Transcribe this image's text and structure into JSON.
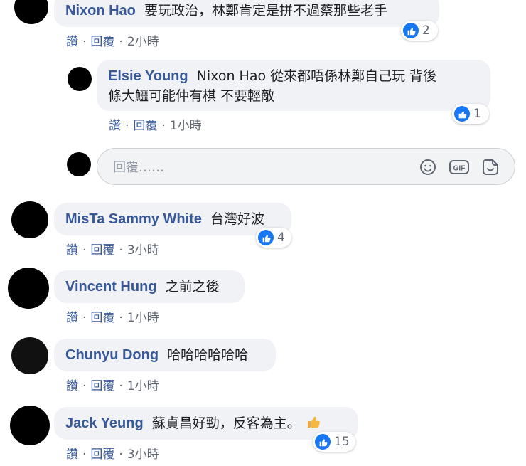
{
  "comments": [
    {
      "author": "Nixon Hao",
      "text": "要玩政治，林鄭肯定是拼不過蔡那些老手",
      "like_action": "讚",
      "reply_action": "回覆",
      "time": "2小時",
      "reactions": "2"
    },
    {
      "author": "Elsie Young",
      "text_line1": "Nixon Hao 從來都唔係林鄭自己玩 背後",
      "text_line2": "條大鱷可能仲有棋 不要輕敵",
      "like_action": "讚",
      "reply_action": "回覆",
      "time": "1小時",
      "reactions": "1"
    },
    {
      "author": "MisTa Sammy White",
      "text": "台灣好波",
      "like_action": "讚",
      "reply_action": "回覆",
      "time": "3小時",
      "reactions": "4"
    },
    {
      "author": "Vincent Hung",
      "text": "之前之後",
      "like_action": "讚",
      "reply_action": "回覆",
      "time": "1小時"
    },
    {
      "author": "Chunyu Dong",
      "text": "哈哈哈哈哈哈",
      "like_action": "讚",
      "reply_action": "回覆",
      "time": "1小時"
    },
    {
      "author": "Jack Yeung",
      "text": "蘇貞昌好勁，反客為主。",
      "emoji": "thumbs-up",
      "like_action": "讚",
      "reply_action": "回覆",
      "time": "3小時",
      "reactions": "15"
    }
  ],
  "reply_box": {
    "placeholder": "回覆……",
    "icons": [
      "smiley-icon",
      "gif-icon",
      "sticker-icon"
    ]
  },
  "colors": {
    "name": "#385898",
    "bubble": "#f0f2f5",
    "like_blue": "#1877f2",
    "meta": "#606770"
  }
}
